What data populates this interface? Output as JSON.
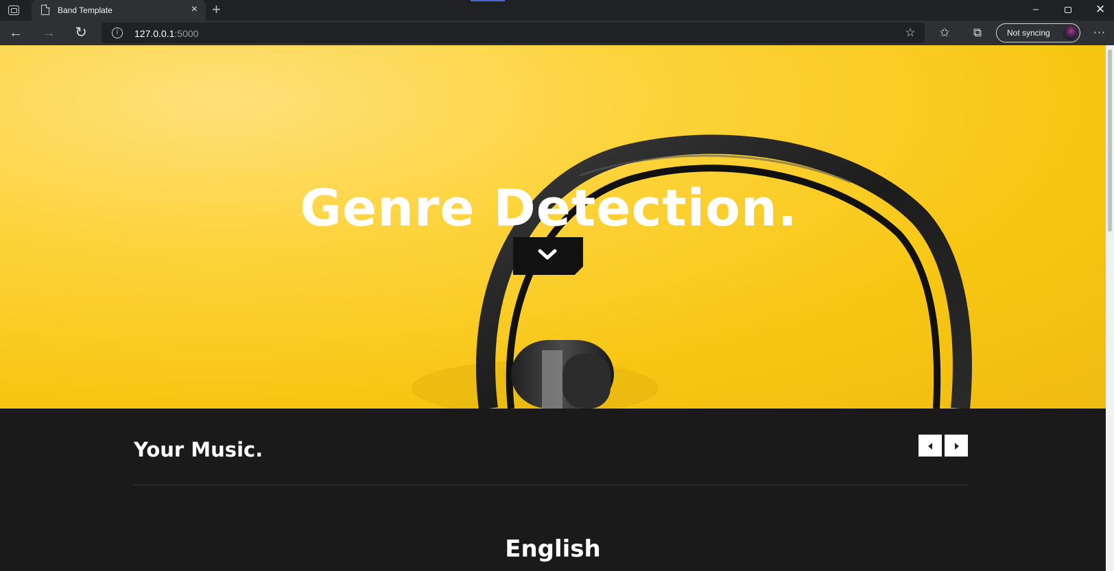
{
  "browser": {
    "tab_title": "Band Template",
    "tab_close": "×",
    "new_tab": "+",
    "url_host": "127.0.0.1",
    "url_port": ":5000",
    "sync_label": "Not syncing",
    "more": "···",
    "window": {
      "minimize": "–",
      "close": "✕"
    },
    "icons": [
      "back-icon",
      "forward-icon",
      "reload-icon",
      "info-icon",
      "add-favorite-icon",
      "favorites-icon",
      "collections-icon",
      "profile-avatar",
      "more-icon"
    ]
  },
  "hero": {
    "title": "Genre Detection.",
    "scroll_button_icon": "chevron-down-icon"
  },
  "section": {
    "title": "Your Music.",
    "prev_icon": "caret-left-icon",
    "next_icon": "caret-right-icon",
    "genre": "English"
  },
  "colors": {
    "hero_yellow": "#f7c613",
    "dark_background": "#1a1a1a",
    "browser_chrome": "#202124"
  }
}
